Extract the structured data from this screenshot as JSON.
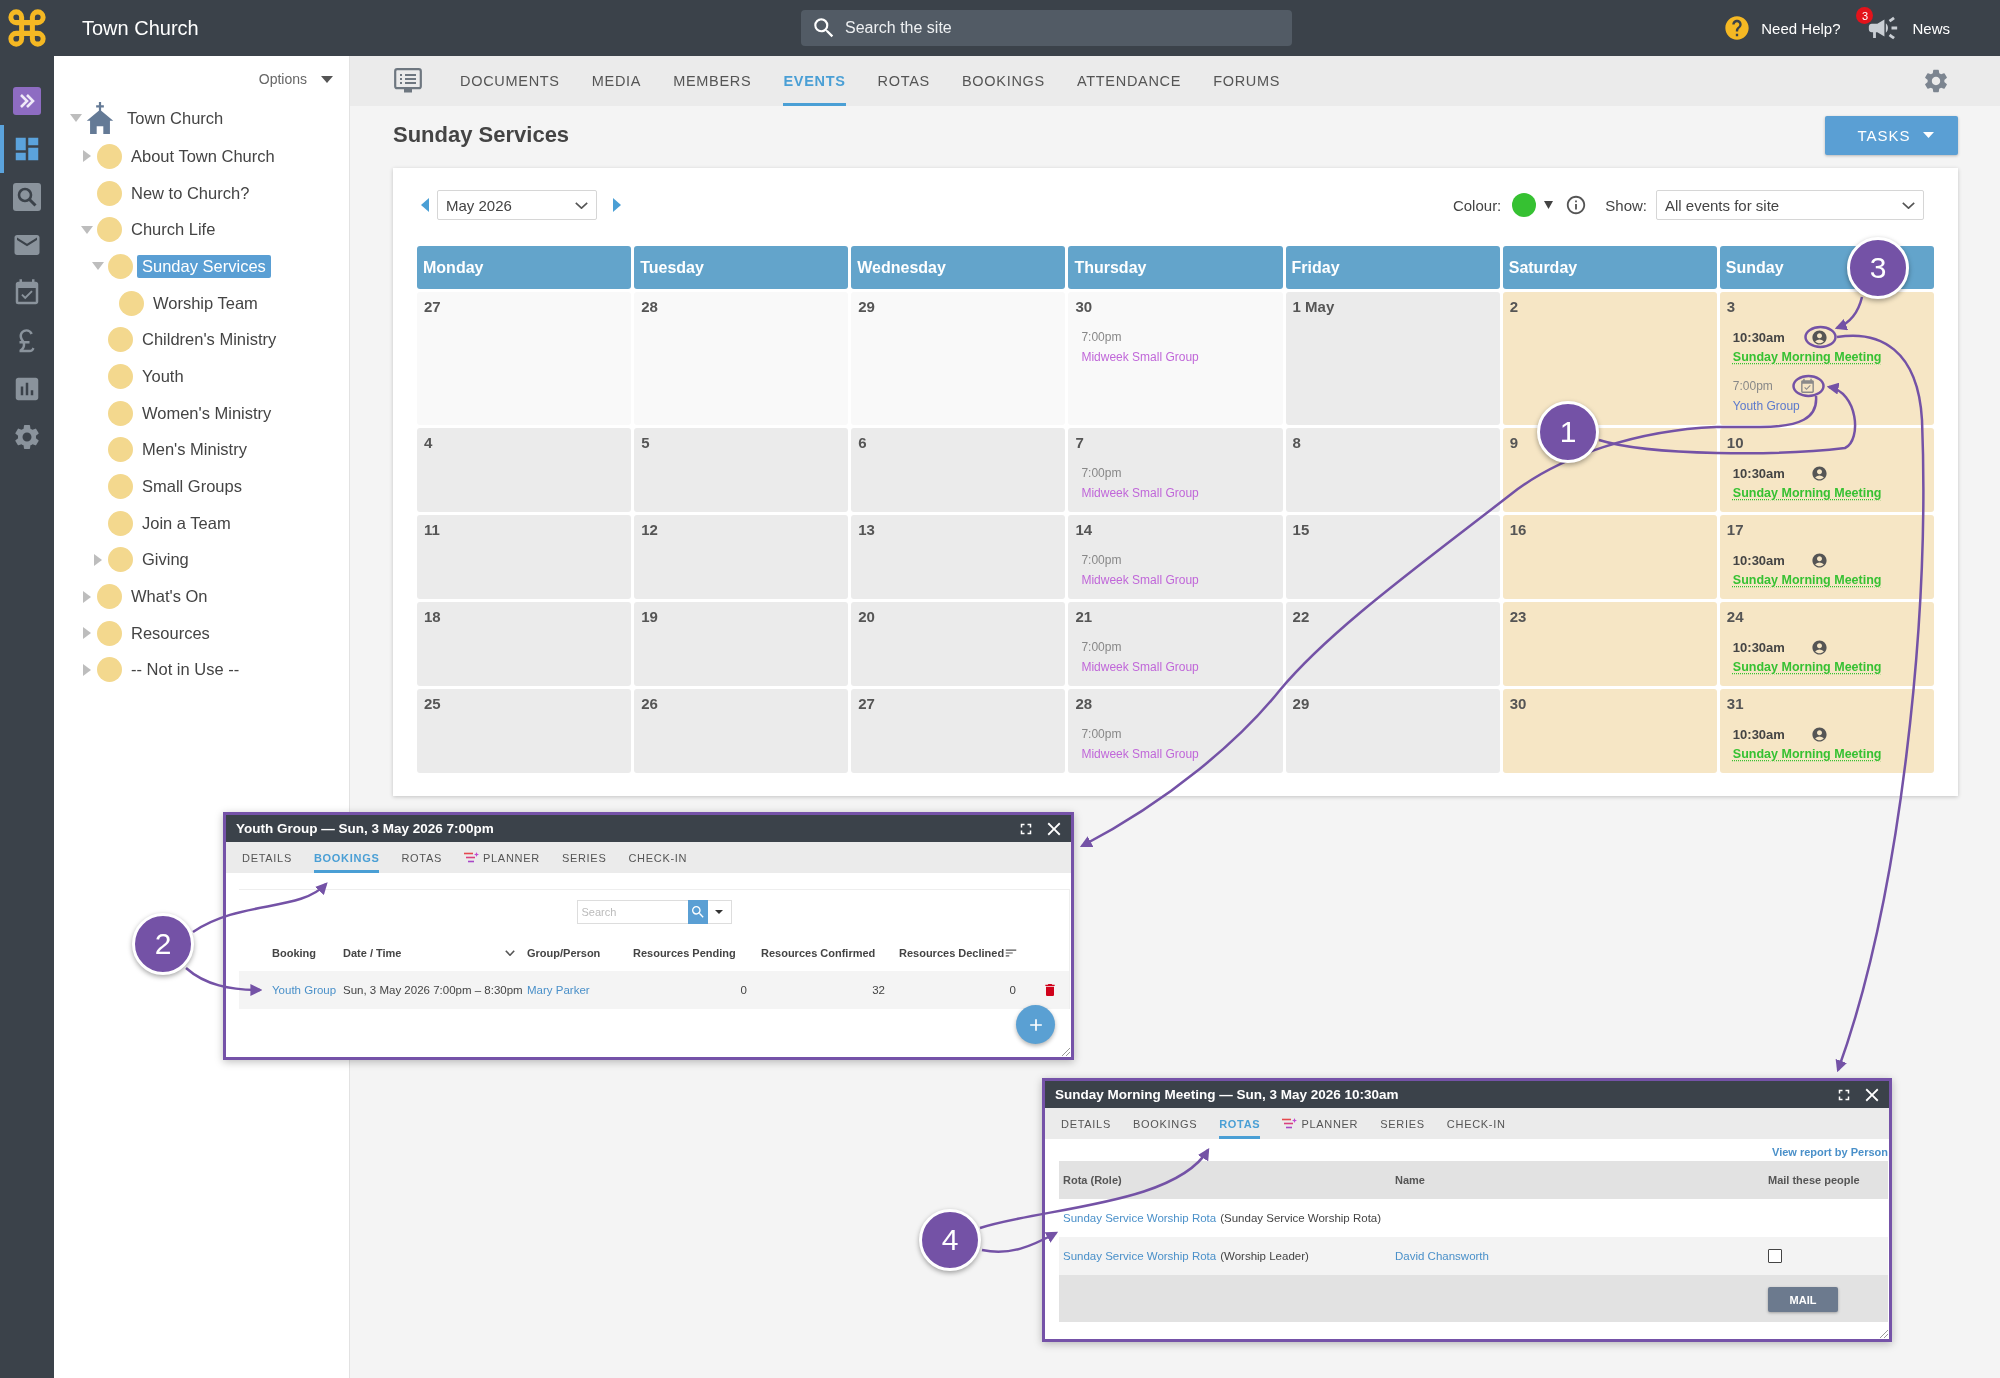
{
  "header": {
    "site_name": "Town Church",
    "search_placeholder": "Search the site",
    "help_label": "Need Help?",
    "news_count": "3",
    "news_label": "News"
  },
  "rail": [
    {
      "kind": "expand",
      "selected": false
    },
    {
      "kind": "dashboard",
      "selected": true
    },
    {
      "kind": "search",
      "selected": false
    },
    {
      "kind": "mail",
      "selected": false
    },
    {
      "kind": "calendar",
      "selected": false
    },
    {
      "kind": "finance",
      "selected": false
    },
    {
      "kind": "reports",
      "selected": false
    },
    {
      "kind": "settings",
      "selected": false
    }
  ],
  "sidebar": {
    "options_label": "Options",
    "tree": [
      {
        "label": "Town Church",
        "kind": "site",
        "expanded": true,
        "selected": false,
        "children": [
          {
            "label": "About Town Church",
            "kind": "page",
            "expanded": false,
            "selected": false
          },
          {
            "label": "New to Church?",
            "kind": "page",
            "selected": false
          },
          {
            "label": "Church Life",
            "kind": "page",
            "expanded": true,
            "selected": false,
            "children": [
              {
                "label": "Sunday Services",
                "kind": "page",
                "expanded": true,
                "selected": true,
                "children": [
                  {
                    "label": "Worship Team",
                    "kind": "page",
                    "selected": false
                  }
                ]
              },
              {
                "label": "Children's Ministry",
                "kind": "page",
                "selected": false
              },
              {
                "label": "Youth",
                "kind": "page",
                "selected": false
              },
              {
                "label": "Women's Ministry",
                "kind": "page",
                "selected": false
              },
              {
                "label": "Men's Ministry",
                "kind": "page",
                "selected": false
              },
              {
                "label": "Small Groups",
                "kind": "page",
                "selected": false
              },
              {
                "label": "Join a Team",
                "kind": "page",
                "selected": false
              },
              {
                "label": "Giving",
                "kind": "page",
                "expanded": false,
                "selected": false
              }
            ]
          },
          {
            "label": "What's On",
            "kind": "page",
            "expanded": false,
            "selected": false
          },
          {
            "label": "Resources",
            "kind": "page",
            "expanded": false,
            "selected": false
          },
          {
            "label": "-- Not in Use --",
            "kind": "page",
            "expanded": false,
            "selected": false
          }
        ]
      }
    ]
  },
  "nav_tabs": [
    {
      "label": "DOCUMENTS",
      "selected": false
    },
    {
      "label": "MEDIA",
      "selected": false
    },
    {
      "label": "MEMBERS",
      "selected": false
    },
    {
      "label": "EVENTS",
      "selected": true
    },
    {
      "label": "ROTAS",
      "selected": false
    },
    {
      "label": "BOOKINGS",
      "selected": false
    },
    {
      "label": "ATTENDANCE",
      "selected": false
    },
    {
      "label": "FORUMS",
      "selected": false
    }
  ],
  "page": {
    "title": "Sunday Services",
    "tasks_label": "TASKS"
  },
  "calendar": {
    "month": "May 2026",
    "colour_label": "Colour:",
    "show_label": "Show:",
    "show_value": "All events for site",
    "columns": [
      {
        "label": "Monday",
        "weekend": false
      },
      {
        "label": "Tuesday",
        "weekend": false
      },
      {
        "label": "Wednesday",
        "weekend": false
      },
      {
        "label": "Thursday",
        "weekend": false
      },
      {
        "label": "Friday",
        "weekend": false
      },
      {
        "label": "Saturday",
        "weekend": true
      },
      {
        "label": "Sunday",
        "weekend": true
      }
    ],
    "weeks": [
      {
        "days": [
          {
            "day": "27",
            "outside_month": true
          },
          {
            "day": "28",
            "outside_month": true
          },
          {
            "day": "29",
            "outside_month": true
          },
          {
            "day": "30",
            "outside_month": true,
            "events": [
              {
                "kind": "plain",
                "time": "7:00pm",
                "title": "Midweek Small Group",
                "color": "#c067d9"
              }
            ]
          },
          {
            "day": "1 May",
            "outside_month": false
          },
          {
            "day": "2",
            "outside_month": false
          },
          {
            "day": "3",
            "outside_month": false,
            "events": [
              {
                "kind": "rota",
                "time": "10:30am",
                "title": "Sunday Morning Meeting",
                "color": "#36c132"
              },
              {
                "kind": "booking",
                "time": "7:00pm",
                "title": "Youth Group",
                "color": "#5c79cc"
              }
            ]
          }
        ]
      },
      {
        "days": [
          {
            "day": "4",
            "outside_month": false
          },
          {
            "day": "5",
            "outside_month": false
          },
          {
            "day": "6",
            "outside_month": false
          },
          {
            "day": "7",
            "outside_month": false,
            "events": [
              {
                "kind": "plain",
                "time": "7:00pm",
                "title": "Midweek Small Group",
                "color": "#c067d9"
              }
            ]
          },
          {
            "day": "8",
            "outside_month": false
          },
          {
            "day": "9",
            "outside_month": false
          },
          {
            "day": "10",
            "outside_month": false,
            "events": [
              {
                "kind": "rota",
                "time": "10:30am",
                "title": "Sunday Morning Meeting",
                "color": "#36c132"
              }
            ]
          }
        ]
      },
      {
        "days": [
          {
            "day": "11",
            "outside_month": false
          },
          {
            "day": "12",
            "outside_month": false
          },
          {
            "day": "13",
            "outside_month": false
          },
          {
            "day": "14",
            "outside_month": false,
            "events": [
              {
                "kind": "plain",
                "time": "7:00pm",
                "title": "Midweek Small Group",
                "color": "#c067d9"
              }
            ]
          },
          {
            "day": "15",
            "outside_month": false
          },
          {
            "day": "16",
            "outside_month": false
          },
          {
            "day": "17",
            "outside_month": false,
            "events": [
              {
                "kind": "rota",
                "time": "10:30am",
                "title": "Sunday Morning Meeting",
                "color": "#36c132"
              }
            ]
          }
        ]
      },
      {
        "days": [
          {
            "day": "18",
            "outside_month": false
          },
          {
            "day": "19",
            "outside_month": false
          },
          {
            "day": "20",
            "outside_month": false
          },
          {
            "day": "21",
            "outside_month": false,
            "events": [
              {
                "kind": "plain",
                "time": "7:00pm",
                "title": "Midweek Small Group",
                "color": "#c067d9"
              }
            ]
          },
          {
            "day": "22",
            "outside_month": false
          },
          {
            "day": "23",
            "outside_month": false
          },
          {
            "day": "24",
            "outside_month": false,
            "events": [
              {
                "kind": "rota",
                "time": "10:30am",
                "title": "Sunday Morning Meeting",
                "color": "#36c132"
              }
            ]
          }
        ]
      },
      {
        "days": [
          {
            "day": "25",
            "outside_month": false
          },
          {
            "day": "26",
            "outside_month": false
          },
          {
            "day": "27",
            "outside_month": false
          },
          {
            "day": "28",
            "outside_month": false,
            "events": [
              {
                "kind": "plain",
                "time": "7:00pm",
                "title": "Midweek Small Group",
                "color": "#c067d9"
              }
            ]
          },
          {
            "day": "29",
            "outside_month": false
          },
          {
            "day": "30",
            "outside_month": false
          },
          {
            "day": "31",
            "outside_month": false,
            "events": [
              {
                "kind": "rota",
                "time": "10:30am",
                "title": "Sunday Morning Meeting",
                "color": "#36c132"
              }
            ]
          }
        ]
      }
    ]
  },
  "booking_dialog": {
    "title": "Youth Group — Sun, 3 May 2026 7:00pm",
    "tabs": [
      {
        "label": "DETAILS",
        "kind": "plain",
        "selected": false
      },
      {
        "label": "BOOKINGS",
        "kind": "plain",
        "selected": true
      },
      {
        "label": "ROTAS",
        "kind": "plain",
        "selected": false
      },
      {
        "label": "PLANNER",
        "kind": "planner",
        "selected": false
      },
      {
        "label": "SERIES",
        "kind": "plain",
        "selected": false
      },
      {
        "label": "CHECK-IN",
        "kind": "plain",
        "selected": false
      }
    ],
    "search_placeholder": "Search",
    "columns": [
      "Booking",
      "Date / Time",
      "Group/Person",
      "Resources Pending",
      "Resources Confirmed",
      "Resources Declined"
    ],
    "rows": [
      {
        "booking": "Youth Group",
        "date_time": "Sun, 3 May 2026 7:00pm – 8:30pm",
        "group_person": "Mary Parker",
        "pending": "0",
        "confirmed": "32",
        "declined": "0"
      }
    ]
  },
  "rota_dialog": {
    "title": "Sunday Morning Meeting — Sun, 3 May 2026 10:30am",
    "tabs": [
      {
        "label": "DETAILS",
        "kind": "plain",
        "selected": false
      },
      {
        "label": "BOOKINGS",
        "kind": "plain",
        "selected": false
      },
      {
        "label": "ROTAS",
        "kind": "plain",
        "selected": true
      },
      {
        "label": "PLANNER",
        "kind": "planner",
        "selected": false
      },
      {
        "label": "SERIES",
        "kind": "plain",
        "selected": false
      },
      {
        "label": "CHECK-IN",
        "kind": "plain",
        "selected": false
      }
    ],
    "report_link": "View report by Person",
    "columns": [
      "Rota (Role)",
      "Name",
      "Mail these people"
    ],
    "rows": [
      {
        "kind": "rota",
        "rota": "Sunday Service Worship Rota",
        "role": "(Sunday Service Worship Rota)"
      },
      {
        "kind": "person",
        "rota": "Sunday Service Worship Rota",
        "role": "(Worship Leader)",
        "name": "David Chansworth",
        "checked": false
      }
    ],
    "mail_button": "MAIL"
  },
  "callouts": [
    {
      "label": "1"
    },
    {
      "label": "2"
    },
    {
      "label": "3"
    },
    {
      "label": "4"
    }
  ]
}
